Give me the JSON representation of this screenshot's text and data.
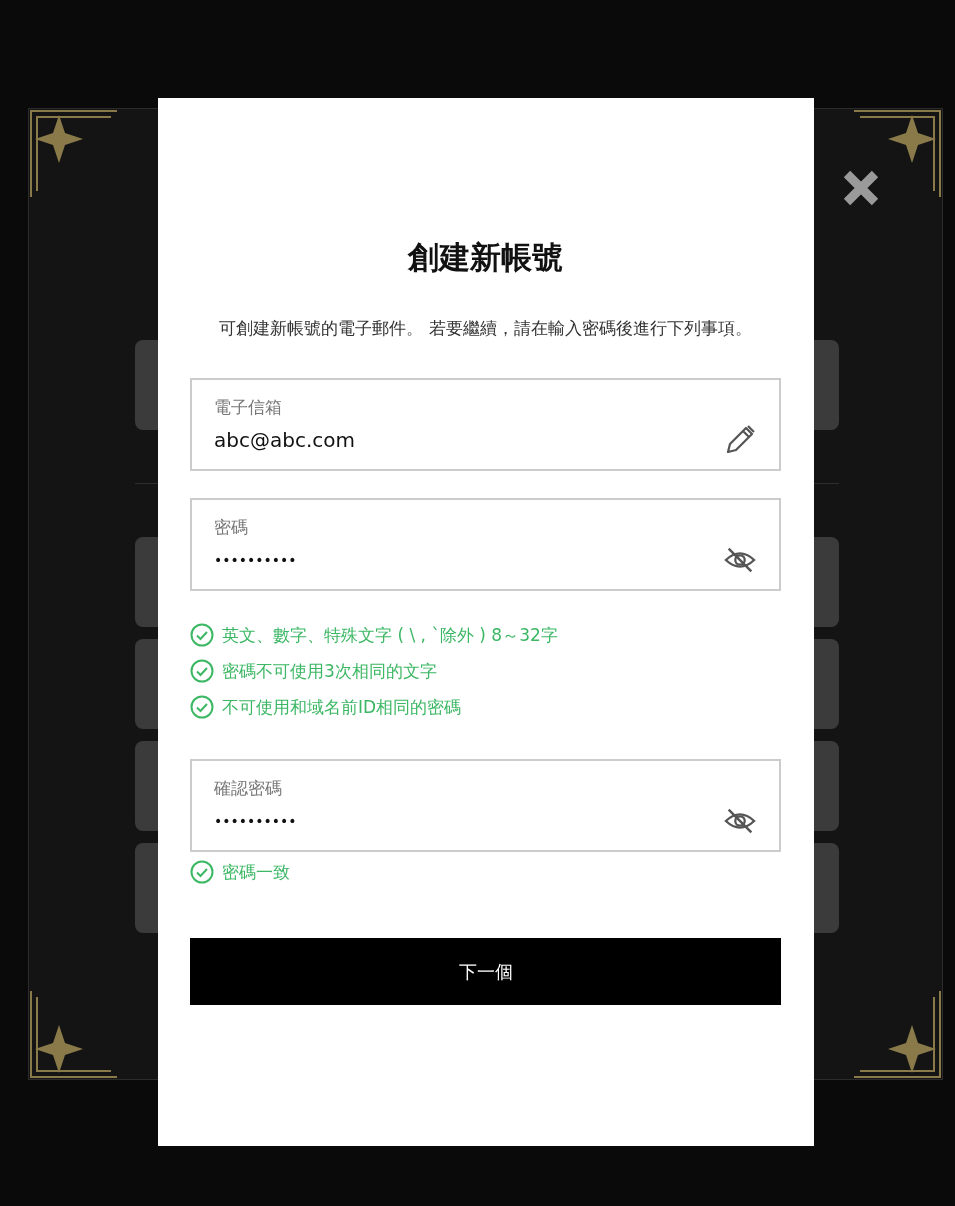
{
  "dialog": {
    "title": "創建新帳號",
    "description": "可創建新帳號的電子郵件。 若要繼續，請在輸入密碼後進行下列事項。",
    "email_field": {
      "label": "電子信箱",
      "value": "abc@abc.com",
      "kind": "edit"
    },
    "password_field": {
      "label": "密碼",
      "value": "••••••••••",
      "kind": "hidden"
    },
    "password_rules": [
      {
        "text": "英文、數字、特殊文字 ( \\ , `除外 ) 8～32字",
        "met": true
      },
      {
        "text": "密碼不可使用3次相同的文字",
        "met": true
      },
      {
        "text": "不可使用和域名前ID相同的密碼",
        "met": true
      }
    ],
    "confirm_field": {
      "label": "確認密碼",
      "value": "••••••••••",
      "kind": "hidden"
    },
    "match_status": {
      "text": "密碼一致",
      "met": true
    },
    "next_button": "下一個"
  }
}
